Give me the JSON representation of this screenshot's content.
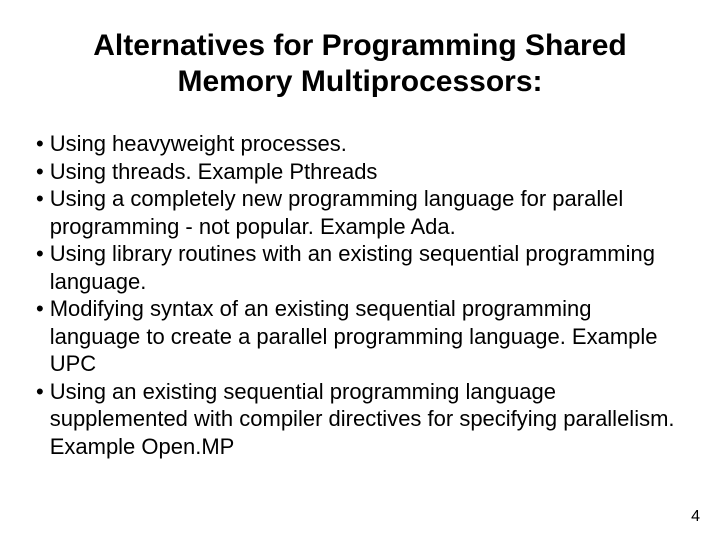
{
  "title_line1": "Alternatives for Programming Shared",
  "title_line2": "Memory Multiprocessors:",
  "bullets": [
    "Using heavyweight processes.",
    "Using threads. Example Pthreads",
    "Using a completely new programming language for parallel programming - not popular. Example Ada.",
    "Using library routines with an existing sequential programming language.",
    "Modifying syntax of an existing sequential programming language to create a parallel programming language. Example UPC",
    "Using an existing sequential programming language supplemented with compiler directives for specifying parallelism. Example Open.MP"
  ],
  "bullet_marker": "•",
  "page_number": "4"
}
